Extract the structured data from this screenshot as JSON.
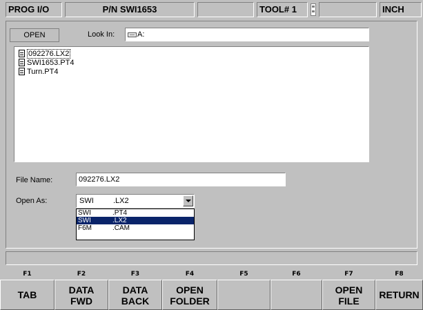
{
  "status_bar": {
    "mode": "PROG I/O",
    "part_number": "P/N SWI1653",
    "tool": "TOOL# 1",
    "units": "INCH"
  },
  "dialog": {
    "open_button": "OPEN",
    "look_in_label": "Look In:",
    "look_in_value": "A:",
    "files": [
      "092276.LX2",
      "SWI1653.PT4",
      "Turn.PT4"
    ],
    "file_name_label": "File Name:",
    "file_name_value": "092276.LX2",
    "open_as_label": "Open As:",
    "open_as_selected": {
      "name": "SWI",
      "ext": ".LX2"
    },
    "open_as_options": [
      {
        "name": "SWI",
        "ext": ".PT4"
      },
      {
        "name": "SWI",
        "ext": ".LX2"
      },
      {
        "name": "F6M",
        "ext": ".CAM"
      }
    ]
  },
  "function_keys": {
    "labels": [
      "F1",
      "F2",
      "F3",
      "F4",
      "F5",
      "F6",
      "F7",
      "F8"
    ],
    "buttons": [
      "TAB",
      "DATA\nFWD",
      "DATA\nBACK",
      "OPEN\nFOLDER",
      "",
      "",
      "OPEN\nFILE",
      "RETURN"
    ]
  },
  "colors": {
    "background": "#c0c0c0",
    "selection": "#0a246a"
  }
}
